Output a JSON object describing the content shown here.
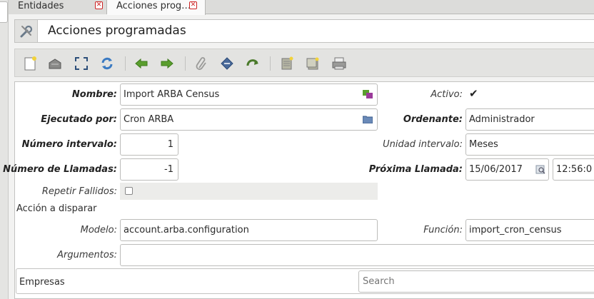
{
  "tabs": [
    {
      "label": "Entidades"
    },
    {
      "label": "Acciones prog…"
    }
  ],
  "header": {
    "title": "Acciones programadas",
    "icon": "tools-icon"
  },
  "toolbar": {
    "buttons": [
      "new-record-icon",
      "save-icon",
      "fullscreen-icon",
      "refresh-icon",
      "previous-icon",
      "next-icon",
      "attachment-icon",
      "print-icon",
      "navigate-icon",
      "copy-icon",
      "paste-icon",
      "printer-icon"
    ]
  },
  "form": {
    "nombre": {
      "label": "Nombre:",
      "value": "Import ARBA Census"
    },
    "activo": {
      "label": "Activo:",
      "checked": true
    },
    "ejecutado": {
      "label": "Ejecutado por:",
      "value": "Cron ARBA"
    },
    "ordenante": {
      "label": "Ordenante:",
      "value": "Administrador"
    },
    "num_intervalo": {
      "label": "Número intervalo:",
      "value": "1"
    },
    "unidad_intervalo": {
      "label": "Unidad intervalo:",
      "value": "Meses"
    },
    "num_llamadas": {
      "label": "Número de Llamadas:",
      "value": "-1"
    },
    "proxima_llamada": {
      "label": "Próxima Llamada:",
      "date": "15/06/2017",
      "time": "12:56:0"
    },
    "repetir_fallidos": {
      "label": "Repetir Fallidos:",
      "checked": false
    },
    "accion_section": "Acción a disparar",
    "modelo": {
      "label": "Modelo:",
      "value": "account.arba.configuration"
    },
    "funcion": {
      "label": "Función:",
      "value": "import_cron_census"
    },
    "argumentos": {
      "label": "Argumentos:",
      "value": ""
    },
    "empresas": {
      "label": "Empresas",
      "search_placeholder": "Search"
    }
  }
}
